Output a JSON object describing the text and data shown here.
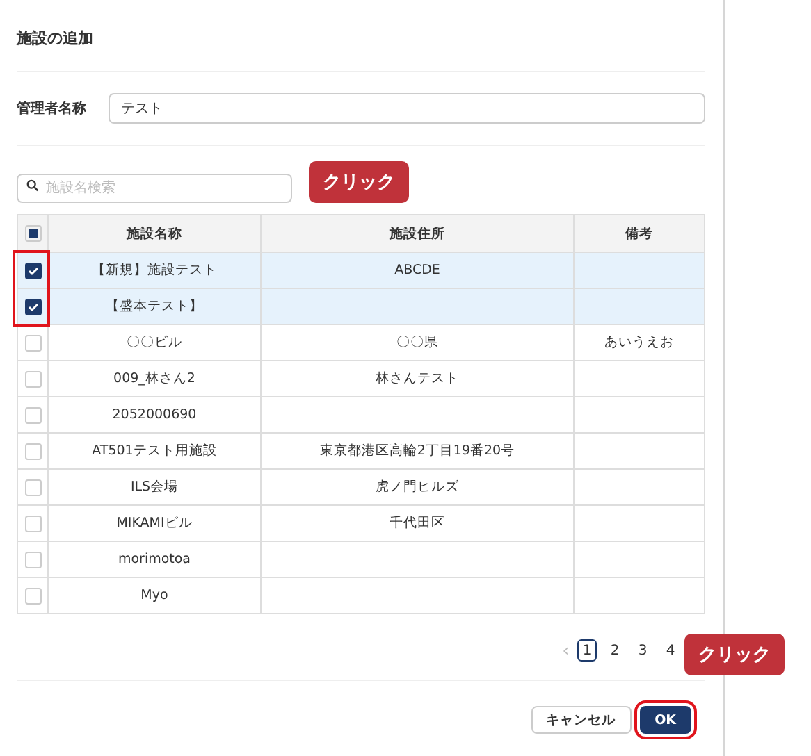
{
  "dialog": {
    "title": "施設の追加"
  },
  "manager": {
    "label": "管理者名称",
    "value": "テスト"
  },
  "search": {
    "placeholder": "施設名検索"
  },
  "table": {
    "select_all": {
      "partial": true
    },
    "columns": [
      "施設名称",
      "施設住所",
      "備考"
    ],
    "rows": [
      {
        "checked": true,
        "cells": [
          "【新規】施設テスト",
          "ABCDE",
          ""
        ]
      },
      {
        "checked": true,
        "cells": [
          "【盛本テスト】",
          "",
          ""
        ]
      },
      {
        "checked": false,
        "cells": [
          "〇〇ビル",
          "〇〇県",
          "あいうえお"
        ]
      },
      {
        "checked": false,
        "cells": [
          "009_林さん2",
          "林さんテスト",
          ""
        ]
      },
      {
        "checked": false,
        "cells": [
          "2052000690",
          "",
          ""
        ]
      },
      {
        "checked": false,
        "cells": [
          "AT501テスト用施設",
          "東京都港区高輪2丁目19番20号",
          ""
        ]
      },
      {
        "checked": false,
        "cells": [
          "ILS会場",
          "虎ノ門ヒルズ",
          ""
        ]
      },
      {
        "checked": false,
        "cells": [
          "MIKAMIビル",
          "千代田区",
          ""
        ]
      },
      {
        "checked": false,
        "cells": [
          "morimotoa",
          "",
          ""
        ]
      },
      {
        "checked": false,
        "cells": [
          "Myo",
          "",
          ""
        ]
      }
    ]
  },
  "pagination": {
    "prev": "‹",
    "pages": [
      {
        "label": "1",
        "selected": true
      },
      {
        "label": "2",
        "selected": false
      },
      {
        "label": "3",
        "selected": false
      },
      {
        "label": "4",
        "selected": false
      }
    ]
  },
  "buttons": [
    {
      "label": "キャンセル",
      "kind": "secondary"
    },
    {
      "label": "OK",
      "kind": "primary"
    }
  ],
  "annotations": [
    {
      "text": "クリック"
    },
    {
      "text": "クリック"
    }
  ]
}
